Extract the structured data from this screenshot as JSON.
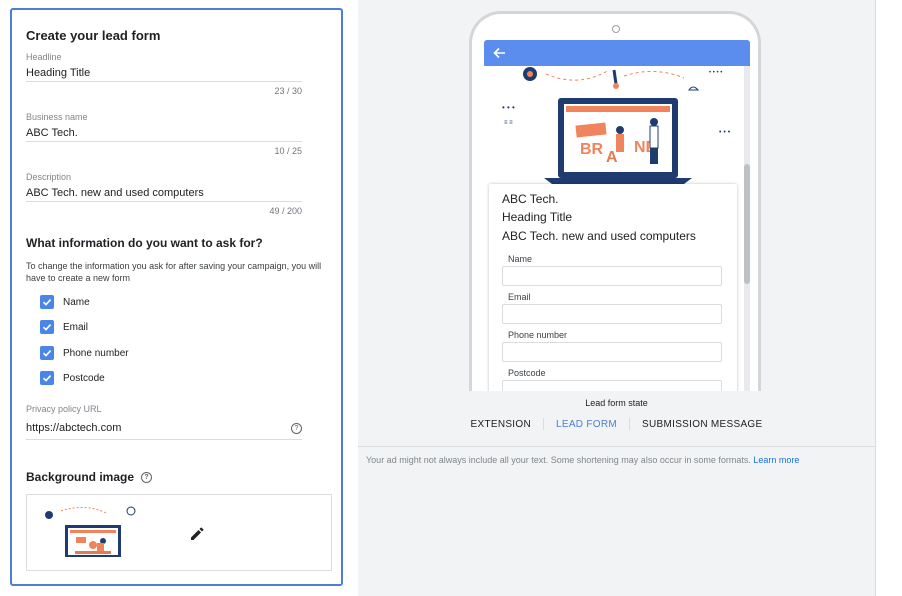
{
  "editor": {
    "title": "Create your lead form",
    "headline": {
      "label": "Headline",
      "value": "Heading Title",
      "counter": "23 / 30"
    },
    "business": {
      "label": "Business name",
      "value": "ABC Tech.",
      "counter": "10 / 25"
    },
    "description": {
      "label": "Description",
      "value": "ABC Tech. new and used computers",
      "counter": "49 / 200"
    },
    "questions": {
      "title": "What information do you want to ask for?",
      "note": "To change the information you ask for after saving your campaign, you will have to create a new form",
      "options": [
        {
          "label": "Name",
          "checked": true
        },
        {
          "label": "Email",
          "checked": true
        },
        {
          "label": "Phone number",
          "checked": true
        },
        {
          "label": "Postcode",
          "checked": true
        }
      ]
    },
    "privacy": {
      "label": "Privacy policy URL",
      "value": "https://abctech.com"
    },
    "background": {
      "title": "Background image"
    }
  },
  "preview": {
    "business": "ABC Tech.",
    "headline": "Heading Title",
    "description": "ABC Tech. new and used computers",
    "fields": [
      "Name",
      "Email",
      "Phone number",
      "Postcode"
    ],
    "state_label": "Lead form state",
    "tabs": [
      {
        "label": "EXTENSION",
        "active": false
      },
      {
        "label": "LEAD FORM",
        "active": true
      },
      {
        "label": "SUBMISSION MESSAGE",
        "active": false
      }
    ],
    "note": "Your ad might not always include all your text. Some shortening may also occur in some formats.",
    "learn_more": "Learn more"
  },
  "colors": {
    "accent": "#4a7fd6",
    "checkbox": "#4a86e8",
    "app_bar": "#5b8def",
    "link": "#1a73e8"
  },
  "icons": {
    "checkbox": "check-icon",
    "help": "help-icon",
    "edit": "pencil-icon",
    "back": "back-arrow-icon"
  }
}
